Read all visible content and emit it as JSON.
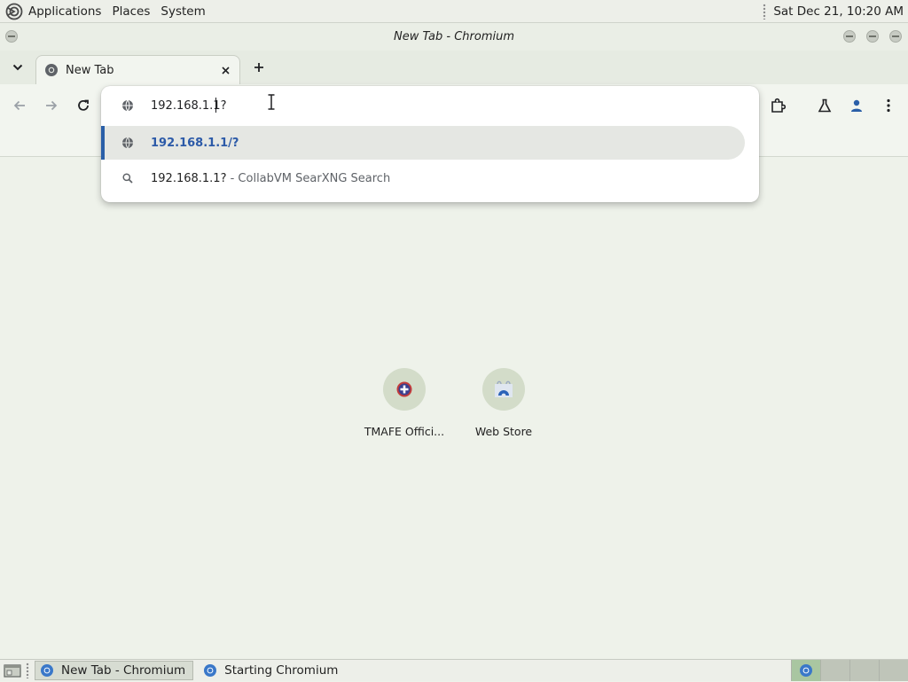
{
  "top_panel": {
    "menus": [
      "Applications",
      "Places",
      "System"
    ],
    "clock": "Sat Dec 21, 10:20 AM"
  },
  "window": {
    "title": "New Tab - Chromium"
  },
  "tabs": [
    {
      "title": "New Tab"
    }
  ],
  "omnibox": {
    "input_value": "192.168.1.1?",
    "suggestions": [
      {
        "text": "192.168.1.1/?",
        "type": "url",
        "selected": true
      },
      {
        "text": "192.168.1.1?",
        "suffix": " - CollabVM SearXNG Search",
        "type": "search",
        "selected": false
      }
    ]
  },
  "ntp": {
    "shortcuts": [
      {
        "label": "TMAFE Offici..."
      },
      {
        "label": "Web Store"
      }
    ]
  },
  "taskbar": {
    "tasks": [
      {
        "label": "New Tab - Chromium",
        "active": true
      },
      {
        "label": "Starting Chromium",
        "active": false
      }
    ]
  },
  "colors": {
    "page_background": "#eef2ea",
    "suggestion_accent": "#2a5fa8",
    "url_suggestion_text": "#2c5aa8"
  },
  "icons": {
    "distro": "distro-logo-icon",
    "tab_favicon": "chromium-favicon-icon",
    "omnibox": "globe-icon",
    "search": "search-icon"
  }
}
